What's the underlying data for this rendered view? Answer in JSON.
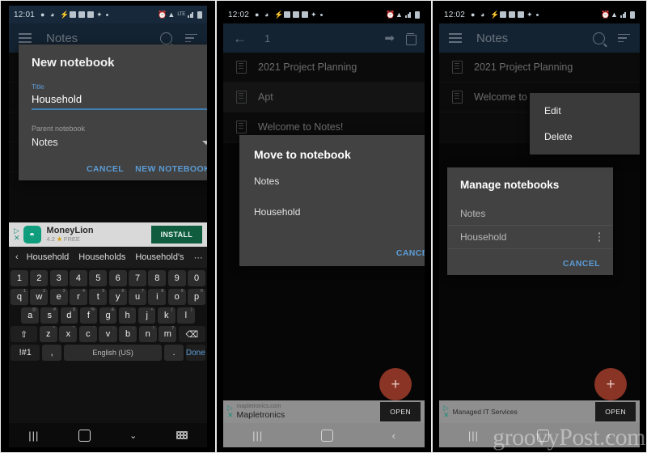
{
  "panel1": {
    "status": {
      "time": "12:01",
      "network": "LTE"
    },
    "toolbar": {
      "title": "Notes"
    },
    "dialog": {
      "heading": "New notebook",
      "title_label": "Title",
      "title_value": "Household",
      "parent_label": "Parent notebook",
      "parent_value": "Notes",
      "cancel": "CANCEL",
      "confirm": "NEW NOTEBOOK"
    },
    "ad": {
      "name": "MoneyLion",
      "rating": "4.2",
      "price": "FREE",
      "button": "INSTALL"
    },
    "suggestions": [
      "Household",
      "Households",
      "Household's"
    ],
    "keyboard": {
      "numbers": [
        "1",
        "2",
        "3",
        "4",
        "5",
        "6",
        "7",
        "8",
        "9",
        "0"
      ],
      "numbers_sup": [
        "",
        "",
        "",
        "",
        "",
        "",
        "",
        "",
        "",
        ""
      ],
      "row1": [
        "q",
        "w",
        "e",
        "r",
        "t",
        "y",
        "u",
        "i",
        "o",
        "p"
      ],
      "row1_sup": [
        "1",
        "2",
        "3",
        "4",
        "5",
        "6",
        "7",
        "8",
        "9",
        "0"
      ],
      "row2": [
        "a",
        "s",
        "d",
        "f",
        "g",
        "h",
        "j",
        "k",
        "l"
      ],
      "row2_sup": [
        "@",
        "#",
        "$",
        "%",
        "&",
        "-",
        "+",
        "(",
        ")"
      ],
      "row3": [
        "z",
        "x",
        "c",
        "v",
        "b",
        "n",
        "m"
      ],
      "row3_sup": [
        "*",
        "\"",
        "'",
        ":",
        ";",
        "!",
        "?"
      ],
      "shift": "⇧",
      "backspace": "⌫",
      "symbols": "!#1",
      "comma": ",",
      "space": "English (US)",
      "period": ".",
      "done": "Done"
    }
  },
  "panel2": {
    "status": {
      "time": "12:02"
    },
    "toolbar": {
      "count": "1"
    },
    "notes": [
      {
        "title": "2021 Project Planning",
        "selected": false
      },
      {
        "title": "Apt",
        "selected": true
      },
      {
        "title": "Welcome to Notes!",
        "selected": false
      }
    ],
    "dialog": {
      "heading": "Move to notebook",
      "options": [
        "Notes",
        "Household"
      ],
      "cancel": "CANCEL"
    },
    "fab": "+",
    "ad": {
      "url": "mapletronics.com",
      "name": "Mapletronics",
      "button": "OPEN"
    }
  },
  "panel3": {
    "status": {
      "time": "12:02"
    },
    "toolbar": {
      "title": "Notes"
    },
    "notes": [
      {
        "title": "2021 Project Planning"
      },
      {
        "title": "Welcome to Notes!"
      }
    ],
    "dialog": {
      "heading": "Manage notebooks",
      "notebooks": [
        "Notes",
        "Household"
      ],
      "cancel": "CANCEL"
    },
    "popup": {
      "items": [
        "Edit",
        "Delete"
      ]
    },
    "fab": "+",
    "ad": {
      "name": "Managed IT Services",
      "button": "OPEN"
    }
  },
  "watermark": "groovyPost.com",
  "colors": {
    "toolbar": "#1e3348",
    "dialog": "#424242",
    "accent": "#5b9bd5",
    "fab": "#8a3425",
    "list_bg": "#111111"
  }
}
